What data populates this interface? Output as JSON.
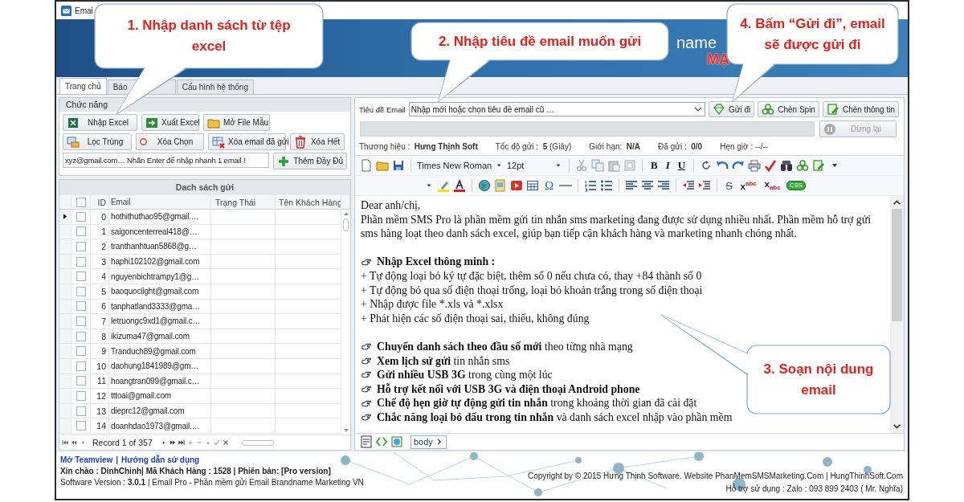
{
  "window": {
    "title": "Emai"
  },
  "banner": {
    "text": "name",
    "subtitle": "MẠ"
  },
  "tabs": [
    {
      "label": "Trang chủ",
      "selected": true
    },
    {
      "label": "Báo",
      "selected": false
    },
    {
      "label": "Cấu hình hệ thống",
      "selected": false
    }
  ],
  "functions": {
    "title": "Chức năng",
    "buttons": [
      "Nhập Excel",
      "Xuất Excel",
      "Mở File Mẫu",
      "Lọc Trùng",
      "Xóa Chọn",
      "Xóa email đã gửi",
      "Xóa Hết"
    ],
    "quick_add": {
      "placeholder": "xyz@gmail.com… Nhấn Enter để nhập nhanh 1 email !",
      "button": "Thêm Đầy Đủ"
    }
  },
  "grid": {
    "title": "Dach sách gửi",
    "all_checked": false,
    "columns": [
      "ID",
      "Email",
      "Trạng Thái",
      "Tên Khách Hàng"
    ],
    "rows": [
      {
        "id": "0",
        "email": "hothithuthao95@gmail.…",
        "checked": false,
        "selected": true
      },
      {
        "id": "1",
        "email": "saigoncenterreal418@…",
        "checked": false,
        "selected": false
      },
      {
        "id": "2",
        "email": "tranthanhtuan5868@g…",
        "checked": false,
        "selected": false
      },
      {
        "id": "3",
        "email": "haphi102102@gmail.com",
        "checked": false,
        "selected": false
      },
      {
        "id": "4",
        "email": "nguyenbichtrampy1@g…",
        "checked": false,
        "selected": false
      },
      {
        "id": "5",
        "email": "baoquoclight@gmail.com",
        "checked": false,
        "selected": false
      },
      {
        "id": "6",
        "email": "tanphatland3333@gma…",
        "checked": false,
        "selected": false
      },
      {
        "id": "7",
        "email": "letruongc9xd1@gmail.c…",
        "checked": false,
        "selected": false
      },
      {
        "id": "8",
        "email": "ikizuma47@gmail.com",
        "checked": false,
        "selected": false
      },
      {
        "id": "9",
        "email": "Tranduch89@gmail.com",
        "checked": false,
        "selected": false
      },
      {
        "id": "10",
        "email": "daohung1841989@gm…",
        "checked": false,
        "selected": false
      },
      {
        "id": "11",
        "email": "hoangtran099@gmail.c…",
        "checked": false,
        "selected": false
      },
      {
        "id": "12",
        "email": "tttoai@gmail.com",
        "checked": false,
        "selected": false
      },
      {
        "id": "13",
        "email": "dieprc12@gmail.com",
        "checked": false,
        "selected": false
      },
      {
        "id": "14",
        "email": "doanhdao1973@gmail.…",
        "checked": false,
        "selected": false
      }
    ],
    "record": "Record 1 of 357"
  },
  "compose": {
    "subject_label": "Tiêu đề Email",
    "subject_placeholder": "Nhập mới hoặc chọn tiêu đề email cũ …",
    "buttons": [
      "Gửi đi",
      "Chèn Spin",
      "Chèn thông tin"
    ],
    "progress": {
      "level": 0
    },
    "stop": {
      "label": "Dừng lại",
      "disabled": true
    },
    "info": [
      {
        "label": "Thương hiệu :",
        "value": "Hưng Thịnh Soft"
      },
      {
        "label": "Tốc độ gửi :",
        "value": "5",
        "unit": "(Giây)"
      },
      {
        "label": "Giới hạn:",
        "value": "N/A"
      },
      {
        "label": "Đã gửi :",
        "value": "0/0"
      },
      {
        "label": "Hẹn giờ : --/--"
      }
    ]
  },
  "editor": {
    "font": "Times New Roman",
    "size": "12pt",
    "format": [
      "B",
      "I",
      "U"
    ],
    "symbol": "Ω",
    "strike": "S",
    "superscript": "x$^{abc}$",
    "subscript": "x$_{abc}$",
    "css": "CSS",
    "path": "body",
    "lines": [
      {
        "kind": "text",
        "text": "Dear anh/chị,"
      },
      {
        "kind": "text",
        "text": "Phần mềm SMS Pro là phần mềm gửi tin nhắn sms marketing đang được sử dụng nhiều nhất. Phần mềm hỗ trợ gửi sms hàng loạt theo danh sách excel, giúp bạn tiếp cận khách hàng và marketing nhanh chóng nhất."
      },
      {
        "kind": "blank"
      },
      {
        "kind": "feature",
        "text": "**Nhập Excel thông minh :**"
      },
      {
        "kind": "text",
        "text": "+ Tự động loại bỏ ký tự đặc biệt, thêm số 0 nếu chưa có, thay +84 thành số 0"
      },
      {
        "kind": "text",
        "text": "+ Tự động bỏ qua số điện thoại trống, loại bỏ khoản trắng trong số điện thoại"
      },
      {
        "kind": "text",
        "text": "+ Nhập được file *.xls và *.xlsx"
      },
      {
        "kind": "text",
        "text": "+ Phát hiện các số điện thoại sai, thiếu, không đúng"
      },
      {
        "kind": "blank"
      },
      {
        "kind": "feature",
        "text": "**Chuyển danh sách theo đầu số mới** theo từng nhà mạng"
      },
      {
        "kind": "feature",
        "text": "**Xem lịch sử gửi** tin nhắn sms"
      },
      {
        "kind": "feature",
        "text": "**Gửi nhiều USB 3G** trong cùng một lúc"
      },
      {
        "kind": "feature",
        "text": "**Hỗ trợ kết nối với USB 3G và điện thoại Android phone**"
      },
      {
        "kind": "feature",
        "text": "**Chế độ hẹn giờ tự động gửi tin nhắn** trong khoảng thời gian đã cài đặt"
      },
      {
        "kind": "feature",
        "text": "**Chắc năng loại bỏ dấu trong tin nhắn** và danh sách excel nhập vào phần mềm"
      }
    ]
  },
  "footer": {
    "links": [
      "Mở Teamview",
      "Hướng dẫn sử dụng"
    ],
    "link_separator": "|",
    "greeting": "Xin chào : DinhChinh| Mã Khách Hàng : 1528 | Phiên bản: [Pro version]",
    "version": "Software Version :  **3.0.1**  | Email Pro - Phần mềm gửi Email Brandname Marketing VN",
    "copyright": "Copyright by © 2015 Hưng Thịnh Software. Website PhanMemSMSMarketing.Com | HungThinhSoft.Com",
    "support": "Hỗ trợ sử dụng : Zalo : 093 899 2403 ( Mr. Nghĩa)"
  },
  "callouts": [
    {
      "text": "1. Nhập danh sách từ tệp excel"
    },
    {
      "text": "2. Nhập tiêu đề email muốn gửi"
    },
    {
      "text": "4. Bấm “Gửi đi”, email sẽ được gửi đi"
    },
    {
      "text": "3. Soạn nội dung email"
    }
  ]
}
